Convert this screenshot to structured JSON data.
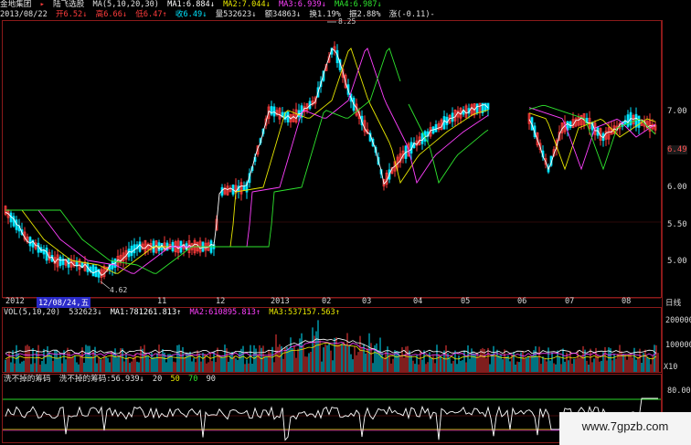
{
  "header": {
    "stock_name": "金地集团",
    "stock_name2": "陆飞选股",
    "ma_label": "MA(5,10,20,30)",
    "ma1": "MA1:6.884↓",
    "ma2": "MA2:7.044↓",
    "ma3": "MA3:6.939↓",
    "ma4": "MA4:6.987↓",
    "date": "2013/08/22",
    "open": "开6.52↓",
    "high": "高6.66↓",
    "low": "低6.47↑",
    "close": "收6.49↓",
    "volume": "量532623↓",
    "amount": "额34863↓",
    "turnover": "换1.19%",
    "amplitude": "振2.88%",
    "change": "涨(-0.11)-"
  },
  "price_axis": {
    "labels": [
      "7.00",
      "6.50",
      "6.00",
      "5.50",
      "5.00"
    ],
    "current": "6.49",
    "high_mark": "8.25",
    "low_mark": "4.62"
  },
  "time_axis": {
    "labels": [
      "2012",
      "12/08/24,五",
      "11",
      "12",
      "2013",
      "02",
      "03",
      "04",
      "05",
      "06",
      "07",
      "08"
    ],
    "period": "日线"
  },
  "volume_panel": {
    "label": "VOL(5,10,20)",
    "vol": "532623↓",
    "ma1": "MA1:781261.813↑",
    "ma2": "MA2:610895.813↑",
    "ma3": "MA3:537157.563↑",
    "axis": [
      "200000",
      "100000"
    ],
    "unit": "X10"
  },
  "indicator_panel": {
    "title": "洗不掉的筹码",
    "value": "洗不掉的筹码:56.939↓",
    "levels": [
      "20",
      "50",
      "70",
      "90"
    ],
    "axis": [
      "80.00"
    ]
  },
  "watermark": "www.7gpzb.com",
  "colors": {
    "up": "#ff3c3c",
    "down": "#00e5ff",
    "ma1": "#ffffff",
    "ma2": "#e8e800",
    "ma3": "#ff40ff",
    "ma4": "#2ee62e",
    "frame": "#8b1a1a"
  }
}
